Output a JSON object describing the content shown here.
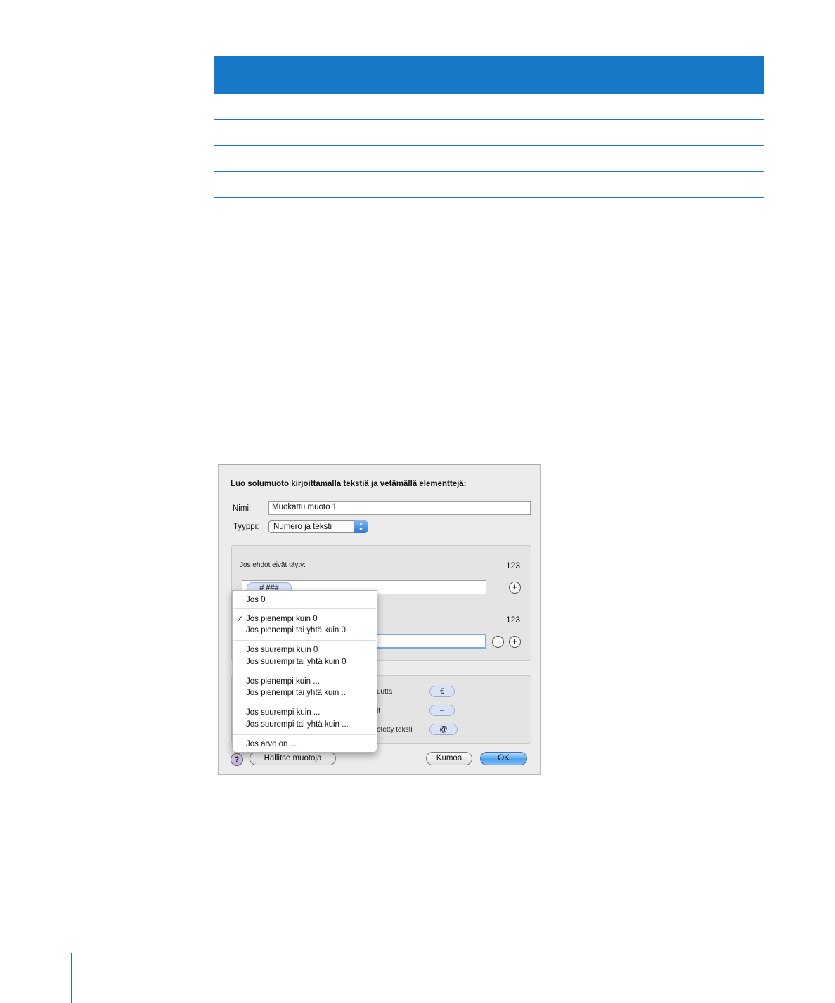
{
  "dialog": {
    "heading": "Luo solumuoto kirjoittamalla tekstiä ja vetämällä elementtejä:",
    "name_label": "Nimi:",
    "name_value": "Muokattu muoto 1",
    "type_label": "Tyyppi:",
    "type_value": "Numero ja teksti",
    "rule1_label": "Jos ehdot eivät täyty:",
    "rule1_sample": "123",
    "token_number": "# ###",
    "rule2_sample": "123",
    "elements": [
      {
        "label": "uutta",
        "token": "€"
      },
      {
        "label": "it",
        "token": "–"
      },
      {
        "label": "ötetty teksti",
        "token": "@"
      }
    ],
    "manage_button": "Hallitse muotoja",
    "help_glyph": "?",
    "cancel_button": "Kumoa",
    "ok_button": "OK",
    "add_glyph": "+",
    "remove_glyph": "−"
  },
  "menu": {
    "checked_glyph": "✓",
    "items": [
      "Jos 0",
      "Jos pienempi kuin 0",
      "Jos pienempi tai yhtä kuin 0",
      "Jos suurempi kuin 0",
      "Jos suurempi tai yhtä kuin 0",
      "Jos pienempi kuin ...",
      "Jos pienempi tai yhtä kuin ...",
      "Jos suurempi kuin ...",
      "Jos suurempi tai yhtä kuin ...",
      "Jos arvo on ..."
    ],
    "checked_index": 1
  }
}
